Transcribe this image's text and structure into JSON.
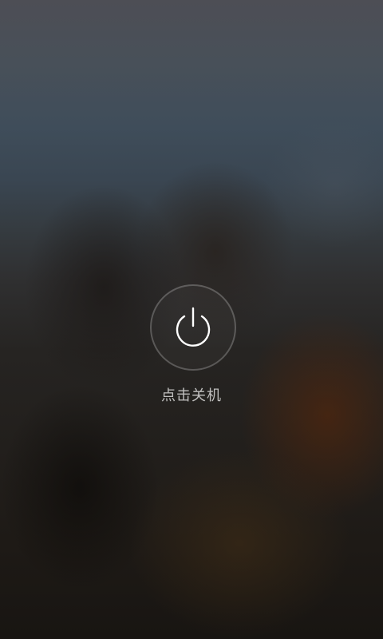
{
  "shutdown": {
    "label": "点击关机",
    "icon": "power-icon"
  },
  "colors": {
    "ring": "#ffffff",
    "label": "#e5e5e5"
  }
}
